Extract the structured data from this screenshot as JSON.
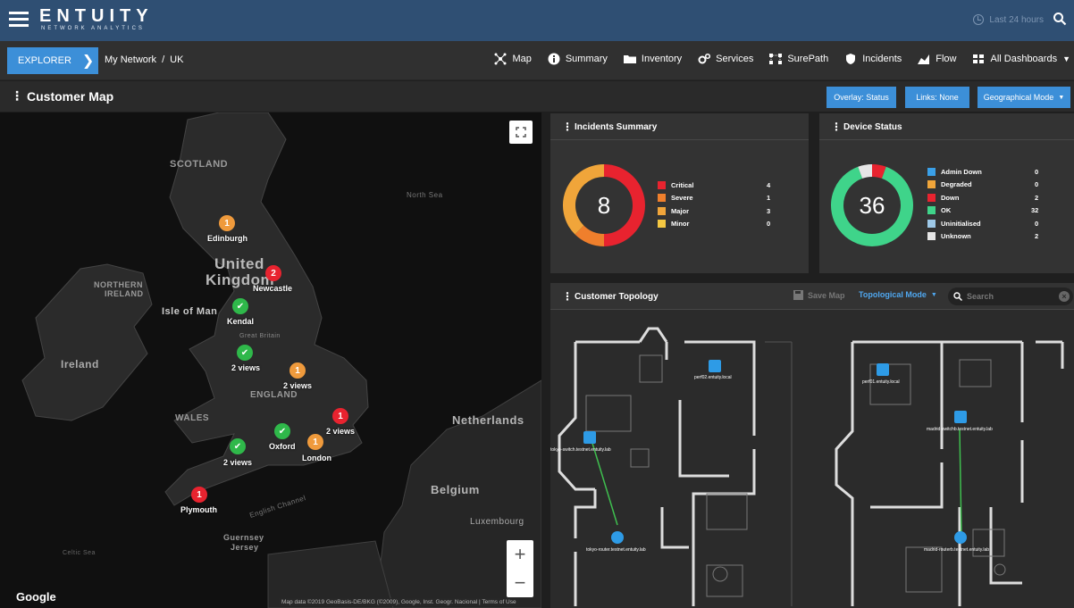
{
  "header": {
    "logo_main": "ENTUITY",
    "logo_sub": "NETWORK ANALYTICS",
    "time_range": "Last 24 hours"
  },
  "nav": {
    "explorer_label": "EXPLORER",
    "breadcrumb": [
      "My Network",
      "/",
      "UK"
    ],
    "links": [
      {
        "label": "Map",
        "icon": "map-icon"
      },
      {
        "label": "Summary",
        "icon": "info-icon"
      },
      {
        "label": "Inventory",
        "icon": "folder-icon"
      },
      {
        "label": "Services",
        "icon": "services-icon"
      },
      {
        "label": "SurePath",
        "icon": "surepath-icon"
      },
      {
        "label": "Incidents",
        "icon": "incidents-icon"
      },
      {
        "label": "Flow",
        "icon": "flow-icon"
      },
      {
        "label": "All Dashboards",
        "icon": "dashboards-icon"
      }
    ]
  },
  "page": {
    "title": "Customer Map",
    "overlay_button": "Overlay: Status",
    "links_button": "Links: None",
    "mode_button": "Geographical Mode"
  },
  "map": {
    "region_labels": [
      "SCOTLAND",
      "North Sea",
      "United",
      "Kingdom",
      "NORTHERN",
      "IRELAND",
      "Isle of Man",
      "Great Britain",
      "Ireland",
      "ENGLAND",
      "WALES",
      "Netherlands",
      "Belgium",
      "Luxembourg",
      "English Channel",
      "Guernsey",
      "Jersey",
      "Celtic Sea"
    ],
    "markers": [
      {
        "label": "Edinburgh",
        "status": "orange",
        "count": "1"
      },
      {
        "label": "Newcastle",
        "status": "red",
        "count": "2"
      },
      {
        "label": "Kendal",
        "status": "green",
        "count": ""
      },
      {
        "label": "2 views",
        "status": "green",
        "count": ""
      },
      {
        "label": "2 views",
        "status": "orange",
        "count": "1"
      },
      {
        "label": "2 views",
        "status": "red",
        "count": "1"
      },
      {
        "label": "Oxford",
        "status": "green",
        "count": ""
      },
      {
        "label": "London",
        "status": "orange",
        "count": "1"
      },
      {
        "label": "2 views",
        "status": "green",
        "count": ""
      },
      {
        "label": "Plymouth",
        "status": "red",
        "count": "1"
      }
    ],
    "google_logo": "Google",
    "attribution": "Map data ©2019 GeoBasis-DE/BKG (©2009), Google, Inst. Geogr. Nacional",
    "terms": "Terms of Use",
    "zoom_in": "+",
    "zoom_out": "−"
  },
  "incidents": {
    "title": "Incidents Summary",
    "total": "8",
    "items": [
      {
        "label": "Critical",
        "value": "4",
        "color": "#e8232f"
      },
      {
        "label": "Severe",
        "value": "1",
        "color": "#ef7f2c"
      },
      {
        "label": "Major",
        "value": "3",
        "color": "#f0a53a"
      },
      {
        "label": "Minor",
        "value": "0",
        "color": "#f5c842"
      }
    ]
  },
  "device_status": {
    "title": "Device Status",
    "total": "36",
    "items": [
      {
        "label": "Admin Down",
        "value": "0",
        "color": "#3aa0e8"
      },
      {
        "label": "Degraded",
        "value": "0",
        "color": "#f0a53a"
      },
      {
        "label": "Down",
        "value": "2",
        "color": "#e8232f"
      },
      {
        "label": "OK",
        "value": "32",
        "color": "#3fd48a"
      },
      {
        "label": "Uninitialised",
        "value": "0",
        "color": "#9ec9e8"
      },
      {
        "label": "Unknown",
        "value": "2",
        "color": "#e6e6e6"
      }
    ]
  },
  "topology": {
    "title": "Customer Topology",
    "save_map": "Save Map",
    "mode": "Topological Mode",
    "search_placeholder": "Search",
    "devices": [
      {
        "label": "perf02.entuity.local"
      },
      {
        "label": "tokyo-switch.testnet.entuity.lab"
      },
      {
        "label": "tokyo-router.testnet.entuity.lab"
      },
      {
        "label": "perf01.entuity.local"
      },
      {
        "label": "madrid-switchb.testnet.entuity.lab"
      },
      {
        "label": "madrid-routerb.testnet.entuity.lab"
      }
    ]
  }
}
